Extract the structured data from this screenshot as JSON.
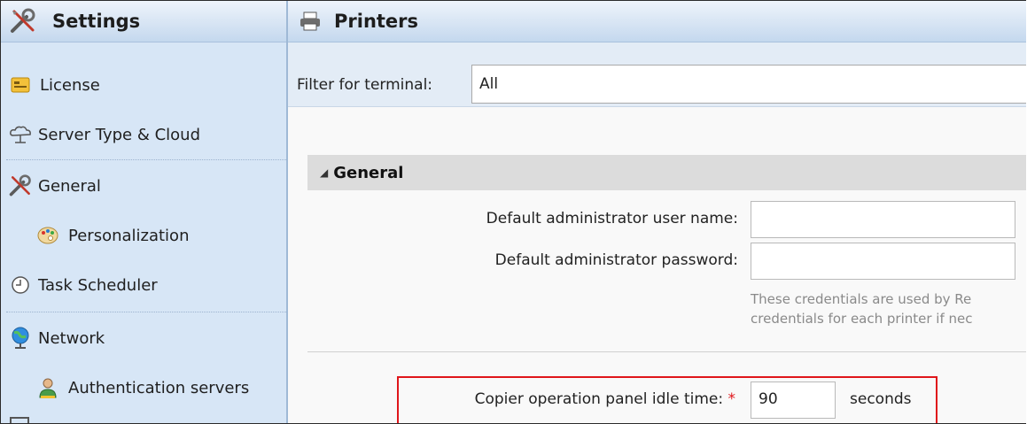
{
  "sidebar": {
    "title": "Settings",
    "title_icon": "tools-icon",
    "items": [
      {
        "label": "License",
        "icon": "license-icon"
      },
      {
        "label": "Server Type & Cloud",
        "icon": "cloud-icon"
      },
      {
        "label": "General",
        "icon": "tools-icon"
      },
      {
        "label": "Personalization",
        "icon": "palette-icon"
      },
      {
        "label": "Task Scheduler",
        "icon": "clock-icon"
      },
      {
        "label": "Network",
        "icon": "globe-icon"
      },
      {
        "label": "Authentication servers",
        "icon": "user-icon"
      }
    ]
  },
  "main": {
    "title": "Printers",
    "title_icon": "printer-icon",
    "filter": {
      "label": "Filter for terminal:",
      "value": "All"
    },
    "section": {
      "title": "General",
      "fields": {
        "admin_user_label": "Default administrator user name:",
        "admin_user_value": "",
        "admin_password_label": "Default administrator password:",
        "admin_password_value": "",
        "hint_line1": "These credentials are used by Re",
        "hint_line2": "credentials for each printer if nec",
        "idle_time_label": "Copier operation panel idle time:",
        "idle_time_required": "*",
        "idle_time_value": "90",
        "idle_time_unit": "seconds"
      }
    }
  },
  "colors": {
    "highlight": "#e0161b",
    "required": "#e0161b",
    "sidebar_bg": "#d7e6f6"
  }
}
